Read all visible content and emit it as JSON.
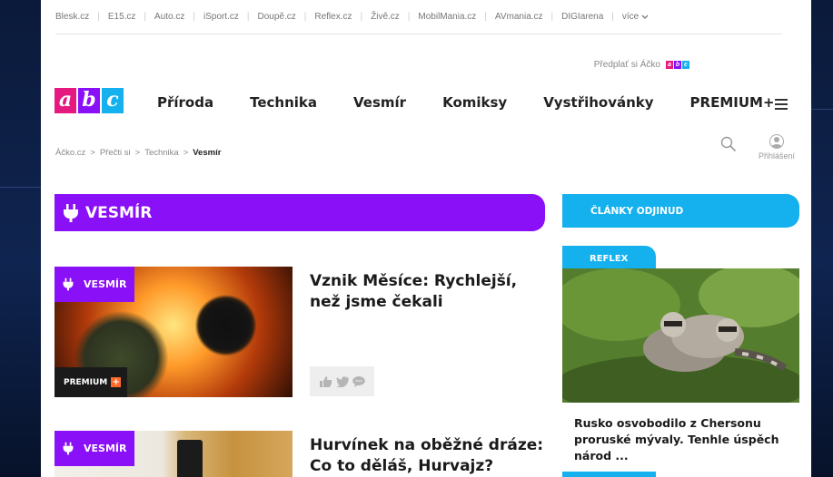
{
  "network_bar": {
    "items": [
      "Blesk.cz",
      "E15.cz",
      "Auto.cz",
      "iSport.cz",
      "Doupě.cz",
      "Reflex.cz",
      "Živě.cz",
      "MobilMania.cz",
      "AVmania.cz",
      "DIGIarena"
    ],
    "more_label": "více"
  },
  "header": {
    "subscribe_label": "Předplať si Áčko",
    "logo_letters": [
      "a",
      "b",
      "c"
    ],
    "nav": [
      "Příroda",
      "Technika",
      "Vesmír",
      "Komiksy",
      "Vystřihovánky",
      "PREMIUM+"
    ]
  },
  "breadcrumb": {
    "items": [
      "Áčko.cz",
      "Přečti si",
      "Technika"
    ],
    "current": "Vesmír",
    "separator": ">"
  },
  "user": {
    "login_label": "Přihlášení"
  },
  "section": {
    "title": "VESMÍR"
  },
  "articles": [
    {
      "tag": "VESMÍR",
      "premium_label": "PREMIUM",
      "title": "Vznik Měsíce: Rychlejší, než jsme čekali"
    },
    {
      "tag": "VESMÍR",
      "title": "Hurvínek na oběžné dráze: Co to děláš, Hurvajz?"
    }
  ],
  "sidebar": {
    "title": "ČLÁNKY ODJINUD",
    "source": "REFLEX",
    "article_title": "Rusko osvobodilo z Chersonu proruské mývaly. Tenhle úspěch národ ..."
  },
  "colors": {
    "purple": "#8a10f7",
    "blue": "#14b1ee",
    "logo_a": "#e5197f",
    "logo_b": "#8a10f7",
    "logo_c": "#14b1ee",
    "premium_plus": "#ff6a2a"
  },
  "icons": [
    "plug-icon",
    "search-icon",
    "user-icon",
    "hamburger-icon",
    "like-icon",
    "twitter-icon",
    "comment-icon",
    "chevron-down-icon"
  ]
}
